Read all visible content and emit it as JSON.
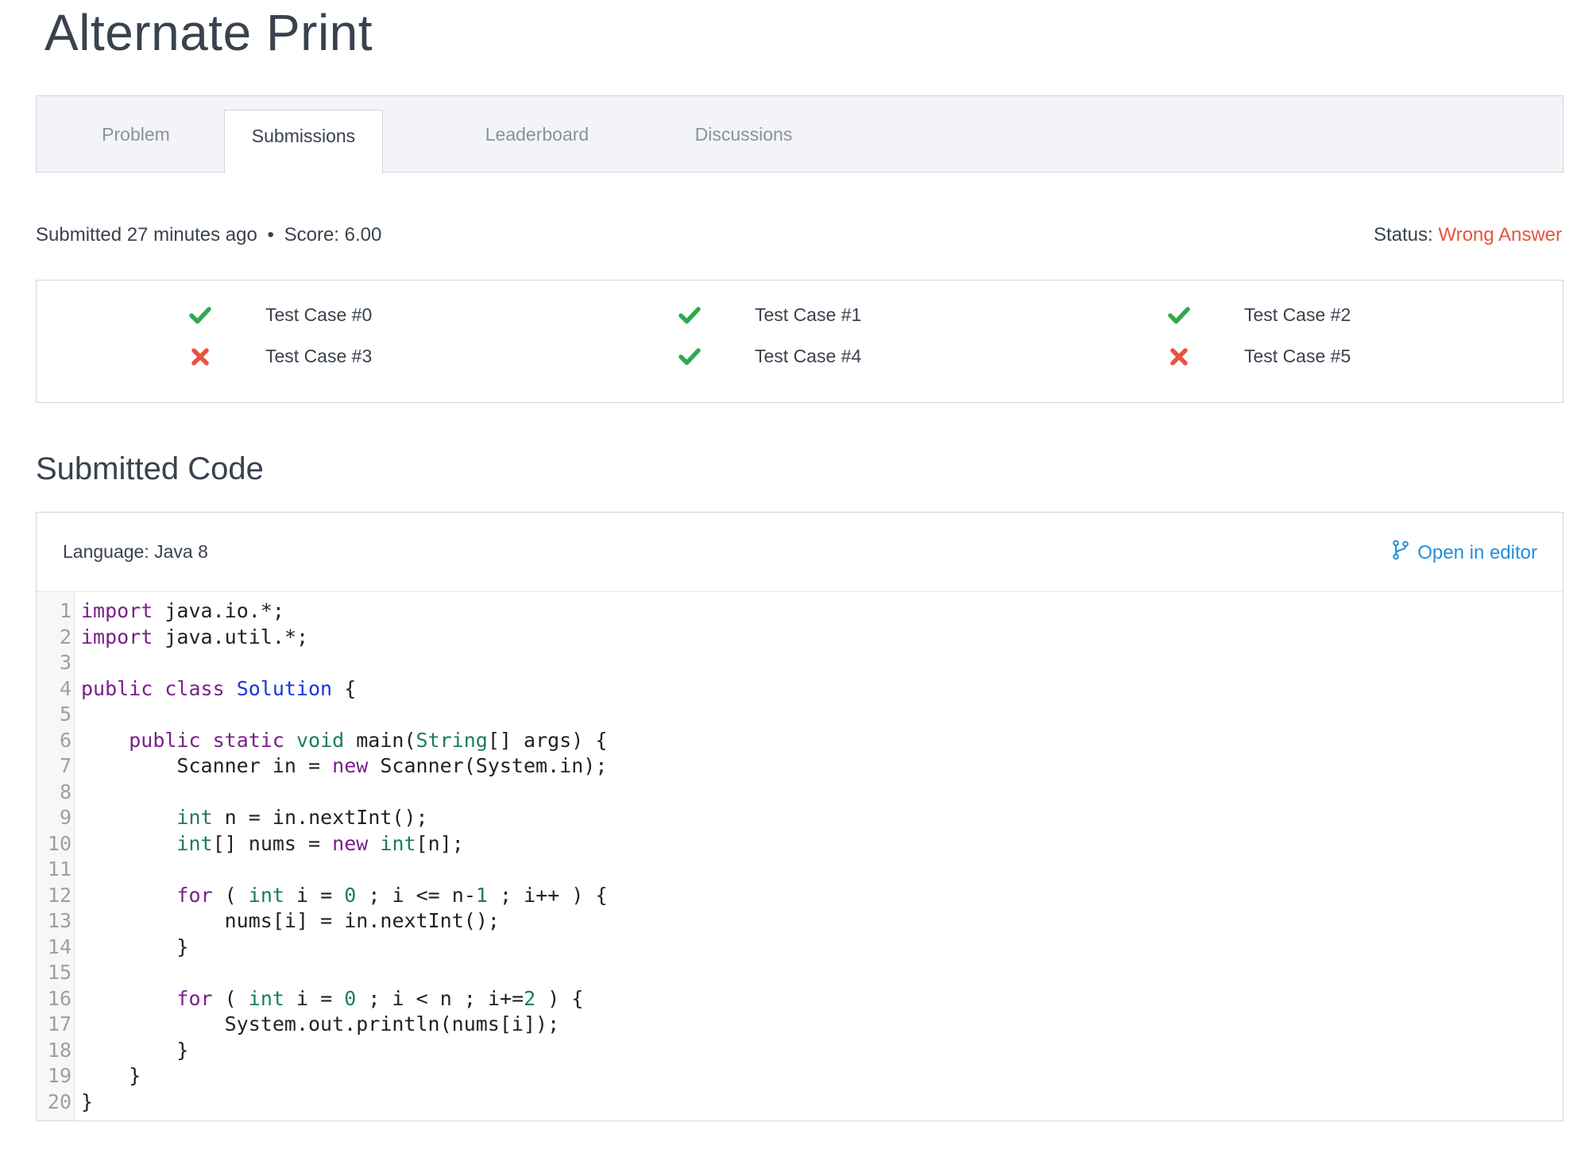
{
  "page": {
    "title": "Alternate Print"
  },
  "tabs": [
    {
      "label": "Problem",
      "active": false
    },
    {
      "label": "Submissions",
      "active": true
    },
    {
      "label": "Leaderboard",
      "active": false
    },
    {
      "label": "Discussions",
      "active": false
    }
  ],
  "submission": {
    "submitted": "Submitted 27 minutes ago",
    "separator": "•",
    "score": "Score: 6.00",
    "status_label": "Status:",
    "status_value": "Wrong Answer"
  },
  "test_cases": [
    {
      "label": "Test Case #0",
      "passed": true
    },
    {
      "label": "Test Case #1",
      "passed": true
    },
    {
      "label": "Test Case #2",
      "passed": true
    },
    {
      "label": "Test Case #3",
      "passed": false
    },
    {
      "label": "Test Case #4",
      "passed": true
    },
    {
      "label": "Test Case #5",
      "passed": false
    }
  ],
  "code_section": {
    "title": "Submitted Code",
    "language": "Language: Java 8",
    "open_in_editor": "Open in editor",
    "editor_icon": "git-branch-icon"
  },
  "code_lines": [
    "import java.io.*;",
    "import java.util.*;",
    "",
    "public class Solution {",
    "",
    "    public static void main(String[] args) {",
    "        Scanner in = new Scanner(System.in);",
    "",
    "        int n = in.nextInt();",
    "        int[] nums = new int[n];",
    "",
    "        for ( int i = 0 ; i <= n-1 ; i++ ) {",
    "            nums[i] = in.nextInt();",
    "        }",
    "",
    "        for ( int i = 0 ; i < n ; i+=2 ) {",
    "            System.out.println(nums[i]);",
    "        }",
    "    }",
    "}"
  ],
  "colors": {
    "pass": "#2eaa4e",
    "fail": "#e9533f",
    "link": "#1f8fe0",
    "keyword": "#7a1f8a",
    "type": "#1b7d5a",
    "class_name": "#1537d6"
  }
}
